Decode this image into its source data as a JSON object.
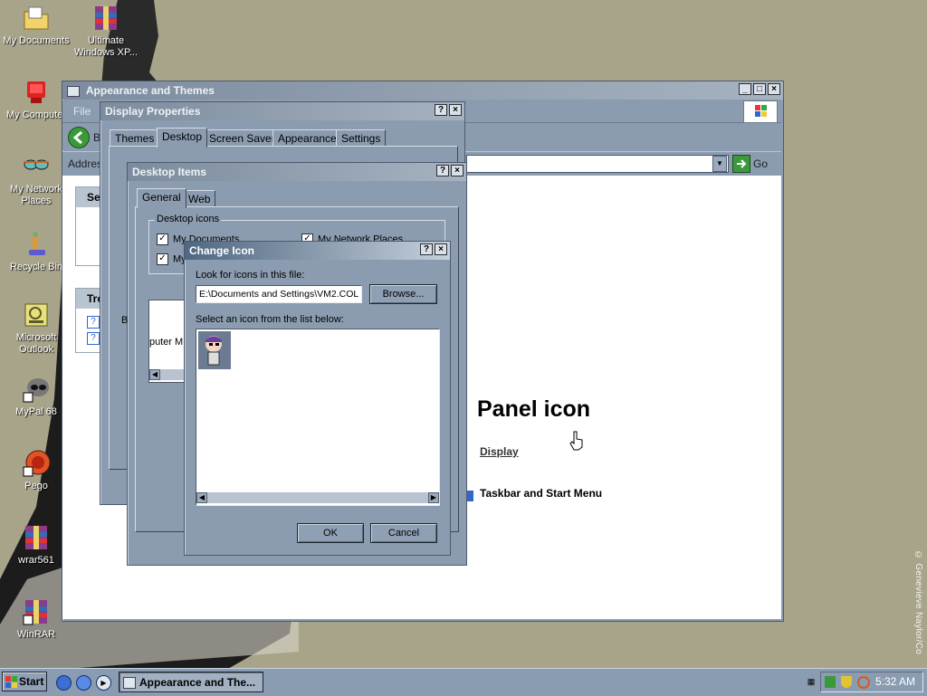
{
  "desktop": {
    "icons": [
      {
        "label": "My Documents"
      },
      {
        "label": "Ultimate Windows XP..."
      },
      {
        "label": "My Computer"
      },
      {
        "label": "My Network Places"
      },
      {
        "label": "Recycle Bin"
      },
      {
        "label": "Microsoft Outlook"
      },
      {
        "label": "MyPal 68"
      },
      {
        "label": "Pego"
      },
      {
        "label": "wrar561"
      },
      {
        "label": "WinRAR"
      }
    ],
    "credit": "© Genevieve Naylor/Co"
  },
  "explorer": {
    "title": "Appearance and Themes",
    "menu_file": "File",
    "back_label": "B",
    "address_label": "Addres",
    "go_label": "Go",
    "side_panel_1": "Se",
    "side_panel_2": "Tro",
    "heading": "Panel icon",
    "link_display": "Display",
    "link_taskbar": "Taskbar and Start Menu"
  },
  "display_properties": {
    "title": "Display Properties",
    "tabs": [
      "Themes",
      "Desktop",
      "Screen Saver",
      "Appearance",
      "Settings"
    ],
    "selected_tab": "Desktop"
  },
  "desktop_items": {
    "title": "Desktop Items",
    "tabs": [
      "General",
      "Web"
    ],
    "group_label": "Desktop icons",
    "checkbox_1": "My Documents",
    "checkbox_2": "My Network Places",
    "checkbox_3": "My",
    "icon_text_1": "puter",
    "icon_text_2": "M",
    "label_b": "B"
  },
  "change_icon": {
    "title": "Change Icon",
    "look_label": "Look for icons in this file:",
    "file_path": "E:\\Documents and Settings\\VM2.COL",
    "browse_label": "Browse...",
    "select_label": "Select an icon from the list below:",
    "ok_label": "OK",
    "cancel_label": "Cancel"
  },
  "taskbar": {
    "start_label": "Start",
    "task_label": "Appearance and The...",
    "clock": "5:32 AM"
  },
  "title_buttons": {
    "help": "?",
    "close": "×",
    "minimize": "_",
    "maximize": "□"
  }
}
